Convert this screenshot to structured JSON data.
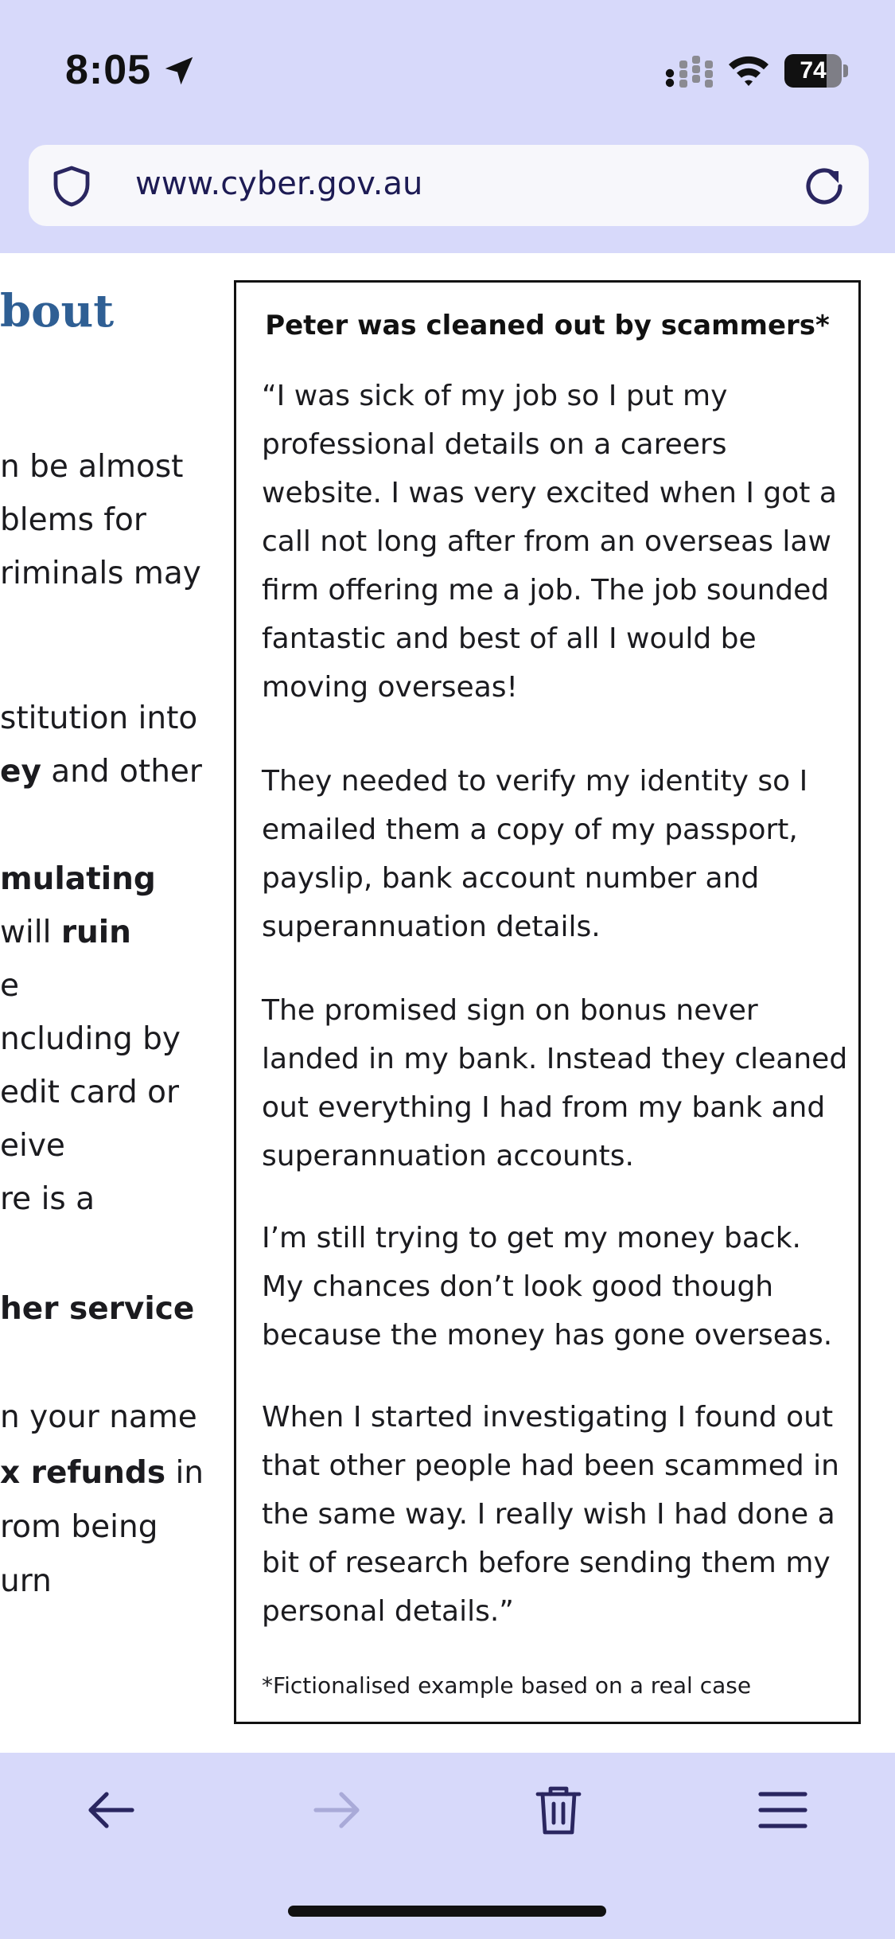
{
  "status_bar": {
    "time": "8:05",
    "battery_level": "74",
    "battery_fraction": 0.74,
    "icons": [
      "location-arrow-icon",
      "signal-icon",
      "wifi-icon",
      "battery-icon"
    ]
  },
  "browser": {
    "url": "www.cyber.gov.au",
    "icons": [
      "shield-icon",
      "reload-icon"
    ]
  },
  "page": {
    "left_column": {
      "heading": "bout",
      "lines": [
        {
          "text": "n be almost"
        },
        {
          "text": "blems for"
        },
        {
          "text": "riminals may"
        },
        {
          "text": "stitution into"
        },
        {
          "bold": "ey",
          "text": " and other"
        },
        {
          "bold": "mulating"
        },
        {
          "text": "will ",
          "bold2": "ruin"
        },
        {
          "text": "e"
        },
        {
          "text": "ncluding by"
        },
        {
          "text": "edit card or"
        },
        {
          "text": "eive"
        },
        {
          "text": "re is a"
        },
        {
          "bold": "her service"
        },
        {
          "text": "n your name"
        },
        {
          "bold": "x refunds",
          "text": " in"
        },
        {
          "text": "rom being"
        },
        {
          "text": "urn"
        }
      ]
    },
    "case_box": {
      "title": "Peter was cleaned out by scammers*",
      "paragraphs": [
        "“I was sick of my job so I put my professional details on a careers website. I was very excited when I got a call not long after from an overseas law firm offering me a job. The job sounded fantastic and best of all I would be moving overseas!",
        "They needed to verify my identity so I emailed them a copy of my passport, payslip, bank account number and superannuation details.",
        "The promised sign on bonus never landed in my bank. Instead they cleaned out everything I had from my bank and superannuation accounts.",
        "I’m still trying to get my money back. My chances don’t look good though because the money has gone overseas.",
        "When I started investigating I found out that other people had been scammed in the same way. I really wish I had done a bit of research before sending them my personal details.”"
      ],
      "footnote": "*Fictionalised example based on a real case"
    }
  },
  "toolbar": {
    "buttons": [
      {
        "name": "back-button",
        "icon": "arrow-left-icon",
        "enabled": true
      },
      {
        "name": "forward-button",
        "icon": "arrow-right-icon",
        "enabled": false
      },
      {
        "name": "delete-data-button",
        "icon": "trash-icon",
        "enabled": true
      },
      {
        "name": "menu-button",
        "icon": "hamburger-menu-icon",
        "enabled": true
      }
    ]
  },
  "colors": {
    "chrome_bg": "#d7d9fa",
    "heading_blue": "#2f5f94",
    "url_text": "#1d1b54",
    "icon_dark": "#2a2660",
    "icon_disabled": "#a9aad8"
  }
}
